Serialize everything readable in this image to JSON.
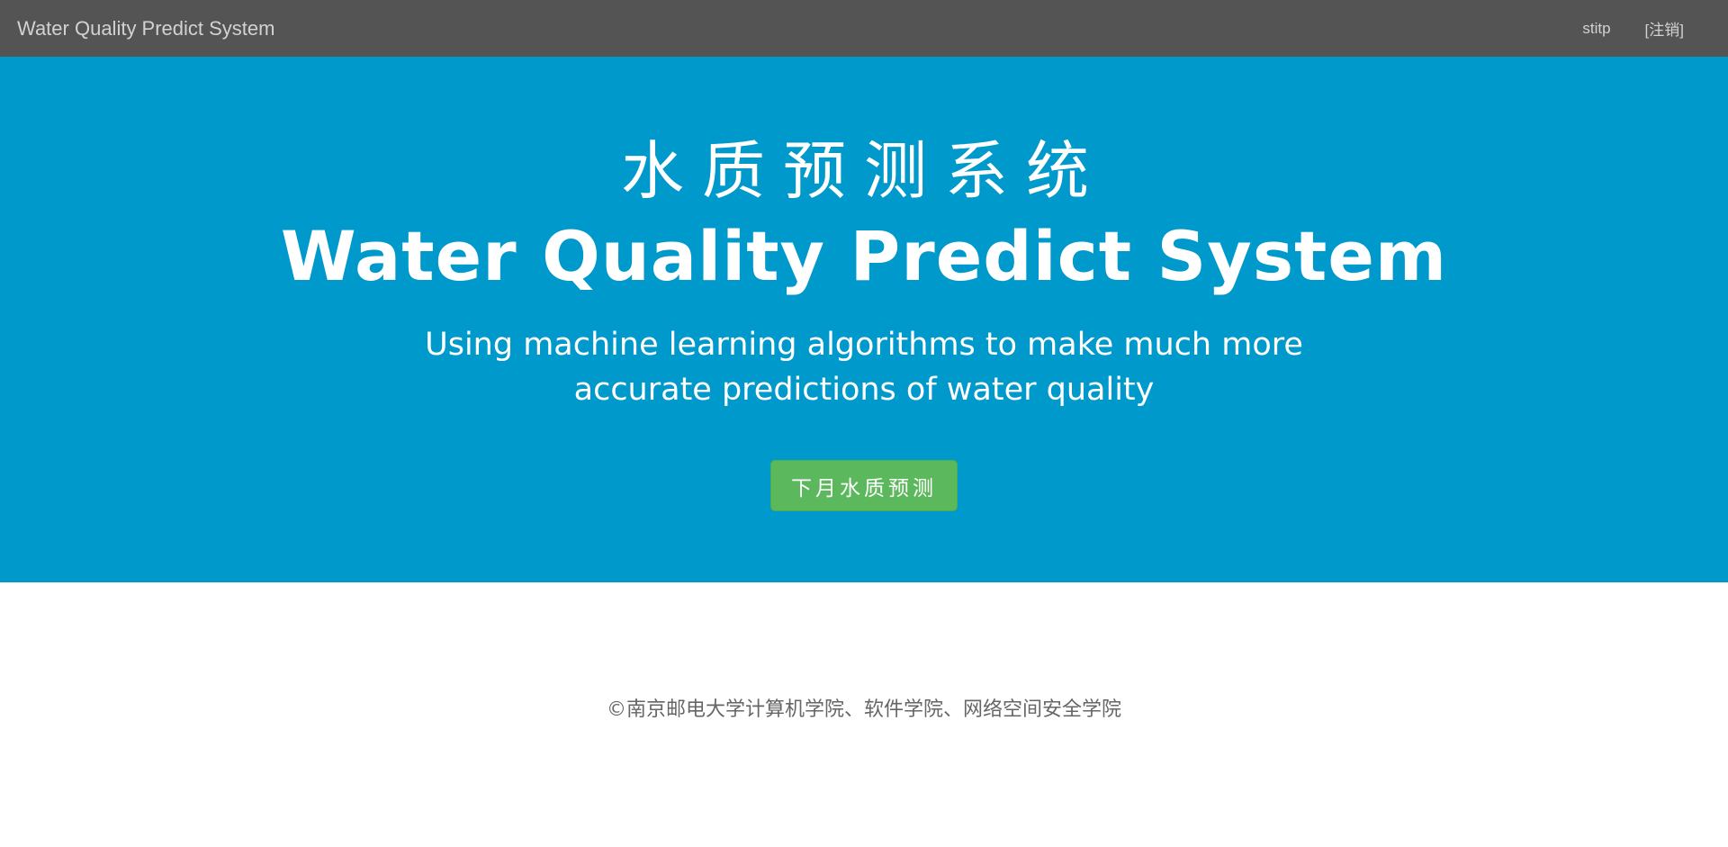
{
  "navbar": {
    "brand": "Water Quality Predict System",
    "user": "stitp",
    "logout": "[注销]"
  },
  "hero": {
    "title_cn": "水质预测系统",
    "title_en": "Water Quality Predict System",
    "subtitle": "Using machine learning algorithms to make much more accurate predictions of water quality",
    "button_label": "下月水质预测"
  },
  "footer": {
    "copyright": "©南京邮电大学计算机学院、软件学院、网络空间安全学院"
  },
  "colors": {
    "navbar_bg": "#545454",
    "hero_bg": "#0099cc",
    "button_bg": "#5cb85c",
    "footer_text": "#666666"
  }
}
